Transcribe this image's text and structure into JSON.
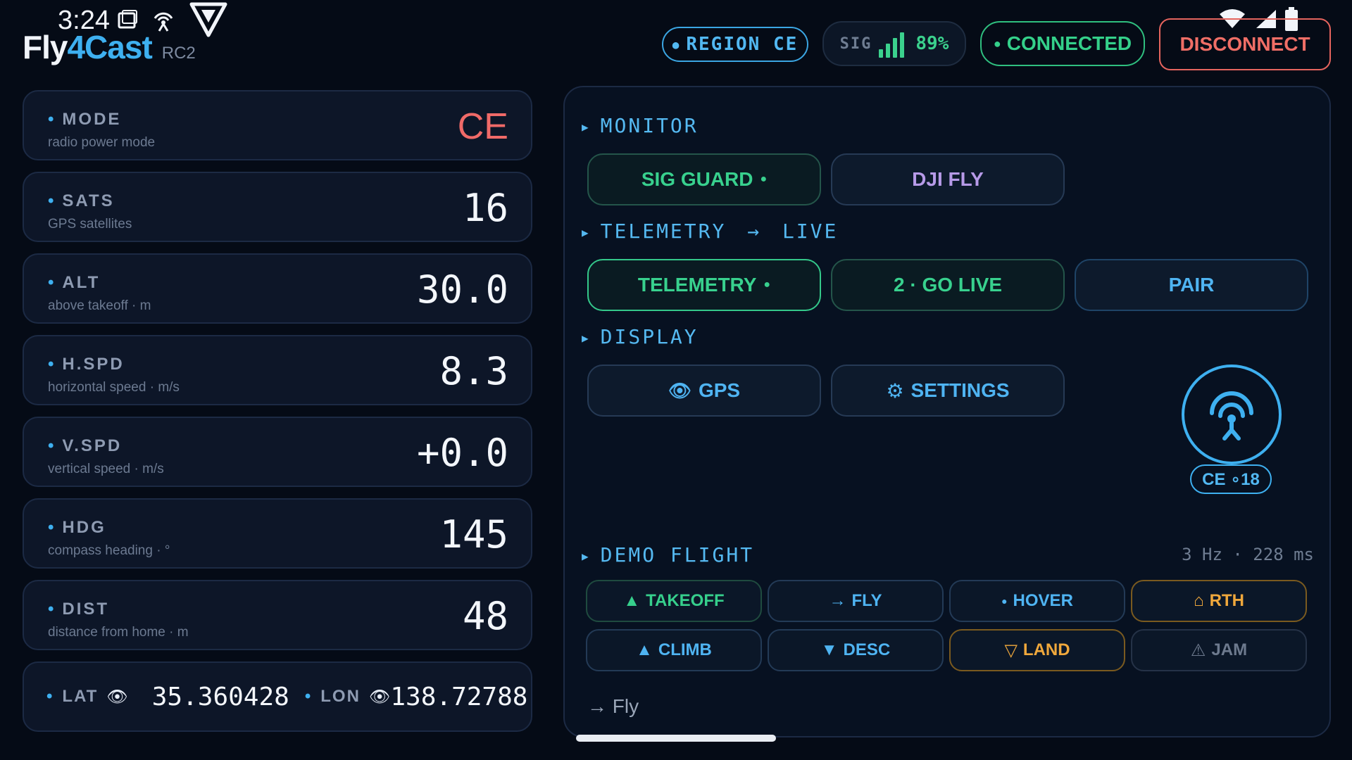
{
  "status_bar": {
    "time": "3:24"
  },
  "brand": {
    "name_part1": "Fly",
    "name_part2": "4Cast",
    "version": "RC2"
  },
  "header": {
    "region": "REGION CE",
    "signal": {
      "label": "SIG",
      "value": "89%",
      "level": 0.89
    },
    "connection": "CONNECTED",
    "disconnect_label": "DISCONNECT"
  },
  "metrics": {
    "mode": {
      "label": "MODE",
      "sub": "radio power mode",
      "value": "CE"
    },
    "sats": {
      "label": "SATS",
      "sub": "GPS satellites",
      "value": "16"
    },
    "alt": {
      "label": "ALT",
      "sub": "above takeoff · m",
      "value": "30.0"
    },
    "hspd": {
      "label": "H.SPD",
      "sub": "horizontal speed · m/s",
      "value": "8.3"
    },
    "vspd": {
      "label": "V.SPD",
      "sub": "vertical speed · m/s",
      "value": "+0.0"
    },
    "hdg": {
      "label": "HDG",
      "sub": "compass heading · °",
      "value": "145"
    },
    "dist": {
      "label": "DIST",
      "sub": "distance from home · m",
      "value": "48"
    },
    "lat": {
      "label": "LAT",
      "value": "35.360428"
    },
    "lon": {
      "label": "LON",
      "value": "138.72788"
    }
  },
  "panel": {
    "monitor": {
      "title": "MONITOR",
      "sig_guard": "SIG GUARD",
      "dji_fly": "DJI FLY"
    },
    "telemetry": {
      "title_a": "TELEMETRY",
      "title_arrow": "→",
      "title_b": "LIVE",
      "telemetry_btn": "TELEMETRY",
      "go_live_btn": "2 · GO LIVE",
      "pair_btn": "PAIR"
    },
    "display": {
      "title": "DISPLAY",
      "gps_btn": "GPS",
      "settings_btn": "SETTINGS"
    },
    "radio_chip": "CE ∘18",
    "demo": {
      "title": "DEMO FLIGHT",
      "rate": "3 Hz · 228 ms",
      "buttons": {
        "takeoff": "TAKEOFF",
        "fly": "FLY",
        "hover": "HOVER",
        "rth": "RTH",
        "climb": "CLIMB",
        "desc": "DESC",
        "land": "LAND",
        "jam": "JAM"
      },
      "glyphs": {
        "takeoff": "▲",
        "fly": "→",
        "hover": "●",
        "rth": "⌂",
        "climb": "▲",
        "desc": "▼",
        "land": "▽",
        "jam": "⚠"
      }
    },
    "status_line": "→ Fly"
  },
  "colors": {
    "accent": "#3eb0f0",
    "green": "#34d08a",
    "danger": "#f06e66",
    "orange": "#f0a83c",
    "violet": "#b69ae8",
    "background": "#050b16"
  }
}
